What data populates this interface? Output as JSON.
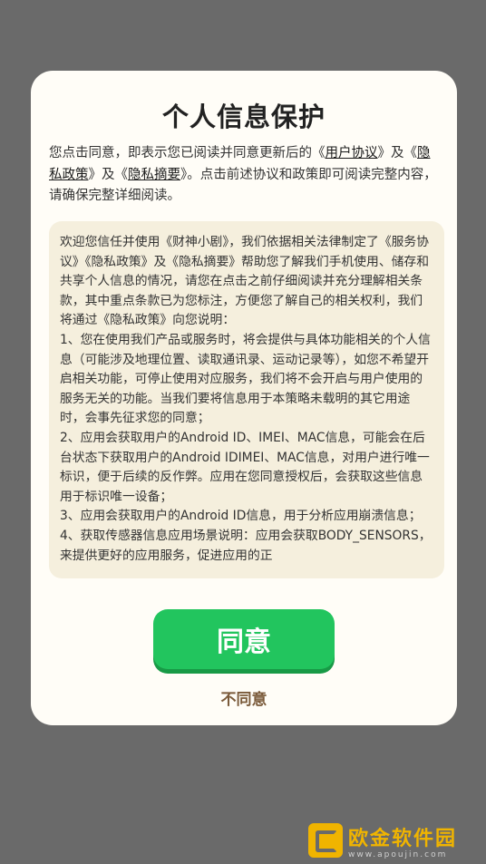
{
  "dialog": {
    "title": "个人信息保护",
    "intro": {
      "part1": "您点击同意，即表示您已阅读并同意更新后的《",
      "link1": "用户协议",
      "part2": "》及《",
      "link2": "隐私政策",
      "part3": "》及《",
      "link3": "隐私摘要",
      "part4": "》。点击前述协议和政策即可阅读完整内容，请确保完整详细阅读。"
    },
    "policy_paragraphs": [
      "欢迎您信任并使用《财神小剧》，我们依据相关法律制定了《服务协议》《隐私政策》及《隐私摘要》帮助您了解我们手机使用、储存和共享个人信息的情况，请您在点击之前仔细阅读并充分理解相关条款，其中重点条款已为您标注，方便您了解自己的相关权利，我们将通过《隐私政策》向您说明：",
      " 1、您在使用我们产品或服务时，将会提供与具体功能相关的个人信息（可能涉及地理位置、读取通讯录、运动记录等），如您不希望开启相关功能，可停止使用对应服务，我们将不会开启与用户使用的服务无关的功能。当我们要将信息用于本策略未载明的其它用途时，会事先征求您的同意；",
      " 2、应用会获取用户的Android ID、IMEI、MAC信息，可能会在后台状态下获取用户的Android IDIMEI、MAC信息，对用户进行唯一标识，便于后续的反作弊。应用在您同意授权后，会获取这些信息用于标识唯一设备；",
      " 3、应用会获取用户的Android ID信息，用于分析应用崩溃信息；",
      " 4、获取传感器信息应用场景说明：应用会获取BODY_SENSORS，来提供更好的应用服务，促进应用的正"
    ],
    "agree_label": "同意",
    "disagree_label": "不同意"
  },
  "watermark": {
    "name": "欧金软件园",
    "url": "www.apoujin.com"
  },
  "colors": {
    "overlay": "#6a6a6a",
    "dialog_bg": "#fffdf7",
    "policy_bg": "#f5efdd",
    "agree_green": "#22c55e",
    "disagree_brown": "#7a5a3a",
    "watermark_gold": "#f0b400"
  }
}
